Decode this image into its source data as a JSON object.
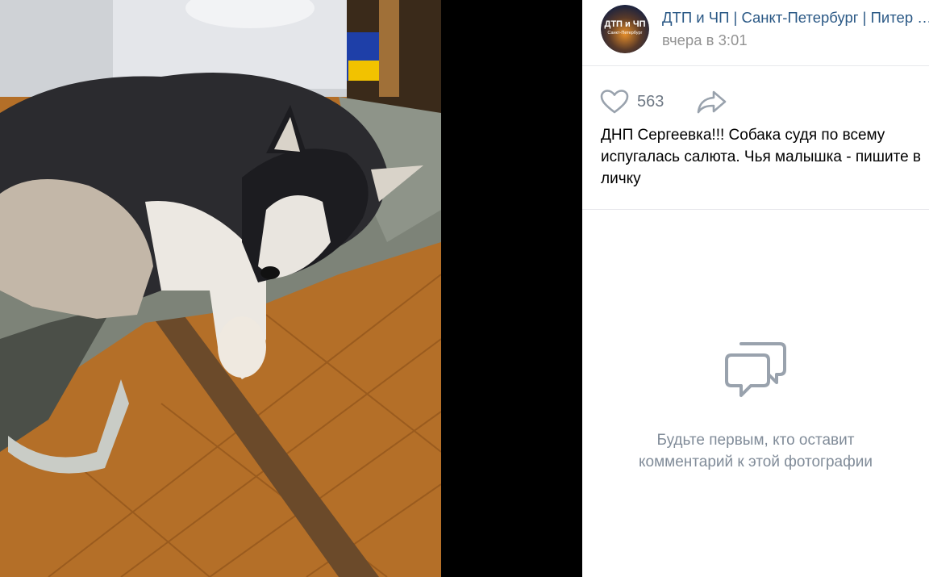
{
  "post": {
    "author": "ДТП и ЧП | Санкт-Петербург | Питер Онлайн | СПб",
    "date": "вчера в 3:01",
    "caption": "ДНП Сергеевка!!! Собака судя по всему испугалась салюта. Чья малышка - пишите в личку",
    "avatar_text_top": "ДТП и ЧП",
    "avatar_text_bottom": "Санкт-Петербург"
  },
  "actions": {
    "like_count": "563",
    "like_icon": "heart-icon",
    "share_icon": "share-arrow-icon"
  },
  "comments": {
    "empty_icon": "comments-icon",
    "empty_line1": "Будьте первым, кто оставит",
    "empty_line2": "комментарий к этой фотографии"
  },
  "colors": {
    "link": "#2a5885",
    "muted": "#939393",
    "icon": "#99a2ad",
    "empty_text": "#818c99"
  }
}
